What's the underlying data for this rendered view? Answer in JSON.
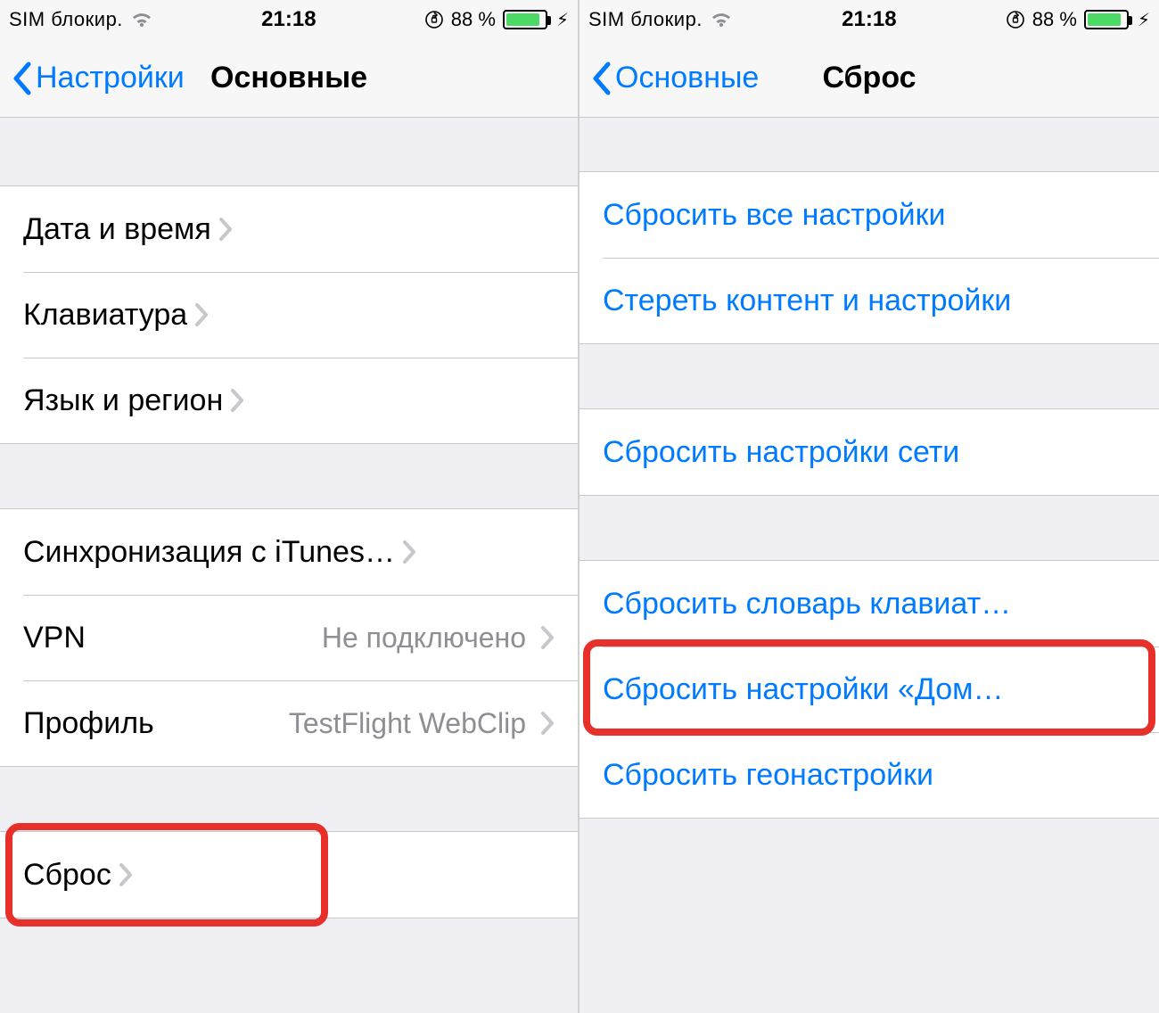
{
  "status": {
    "sim": "SIM блокир.",
    "time": "21:18",
    "battery_pct": "88 %",
    "battery_fill_pct": 88
  },
  "left": {
    "back_label": "Настройки",
    "title": "Основные",
    "group1": [
      {
        "label": "Дата и время"
      },
      {
        "label": "Клавиатура"
      },
      {
        "label": "Язык и регион"
      }
    ],
    "group2": [
      {
        "label": "Синхронизация с iTunes…"
      },
      {
        "label": "VPN",
        "value": "Не подключено"
      },
      {
        "label": "Профиль",
        "value": "TestFlight WebClip"
      }
    ],
    "group3": [
      {
        "label": "Сброс"
      }
    ]
  },
  "right": {
    "back_label": "Основные",
    "title": "Сброс",
    "group1": [
      {
        "label": "Сбросить все настройки"
      },
      {
        "label": "Стереть контент и настройки"
      }
    ],
    "group2": [
      {
        "label": "Сбросить настройки сети"
      }
    ],
    "group3": [
      {
        "label": "Сбросить словарь клавиат…"
      },
      {
        "label": "Сбросить настройки «Дом…"
      },
      {
        "label": "Сбросить геонастройки"
      }
    ]
  }
}
